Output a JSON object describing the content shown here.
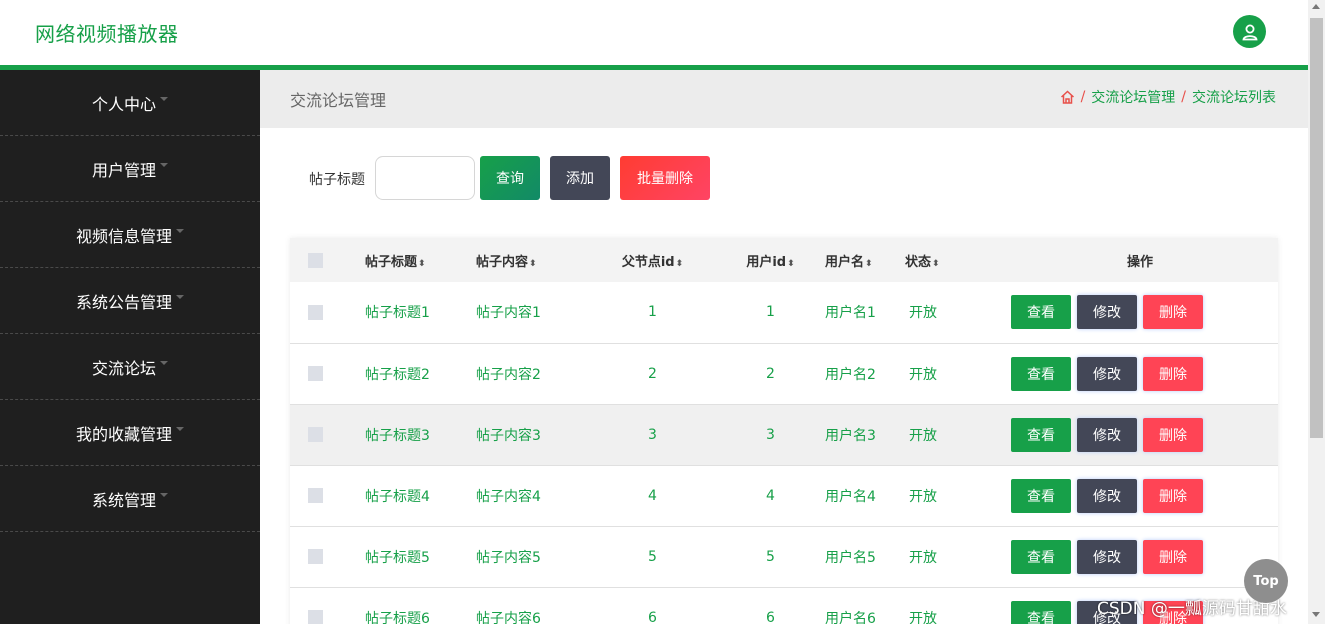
{
  "colors": {
    "accent": "#17a049",
    "sidebar_bg": "#1f1f1f",
    "danger": "#ff4455",
    "dark_btn": "#434757"
  },
  "header": {
    "brand": "网络视频播放器",
    "avatar_icon": "user-icon"
  },
  "sidebar": {
    "items": [
      {
        "label": "个人中心"
      },
      {
        "label": "用户管理"
      },
      {
        "label": "视频信息管理"
      },
      {
        "label": "系统公告管理"
      },
      {
        "label": "交流论坛"
      },
      {
        "label": "我的收藏管理"
      },
      {
        "label": "系统管理"
      }
    ]
  },
  "page": {
    "title": "交流论坛管理",
    "breadcrumb": {
      "home_icon": "home-icon",
      "sep": "/",
      "item1": "交流论坛管理",
      "item2": "交流论坛列表"
    }
  },
  "search": {
    "label": "帖子标题",
    "value": "",
    "query_btn": "查询",
    "add_btn": "添加",
    "batch_delete_btn": "批量删除"
  },
  "table": {
    "headers": {
      "title": "帖子标题",
      "content": "帖子内容",
      "parent_id": "父节点id",
      "user_id": "用户id",
      "username": "用户名",
      "status": "状态",
      "ops": "操作"
    },
    "sort_glyph": "⬍",
    "actions": {
      "view": "查看",
      "edit": "修改",
      "delete": "删除"
    },
    "rows": [
      {
        "title": "帖子标题1",
        "content": "帖子内容1",
        "parent_id": "1",
        "user_id": "1",
        "username": "用户名1",
        "status": "开放"
      },
      {
        "title": "帖子标题2",
        "content": "帖子内容2",
        "parent_id": "2",
        "user_id": "2",
        "username": "用户名2",
        "status": "开放"
      },
      {
        "title": "帖子标题3",
        "content": "帖子内容3",
        "parent_id": "3",
        "user_id": "3",
        "username": "用户名3",
        "status": "开放"
      },
      {
        "title": "帖子标题4",
        "content": "帖子内容4",
        "parent_id": "4",
        "user_id": "4",
        "username": "用户名4",
        "status": "开放"
      },
      {
        "title": "帖子标题5",
        "content": "帖子内容5",
        "parent_id": "5",
        "user_id": "5",
        "username": "用户名5",
        "status": "开放"
      },
      {
        "title": "帖子标题6",
        "content": "帖子内容6",
        "parent_id": "6",
        "user_id": "6",
        "username": "用户名6",
        "status": "开放"
      }
    ]
  },
  "top_button": "Top",
  "watermark": "CSDN @一瓢源码甘甜水"
}
